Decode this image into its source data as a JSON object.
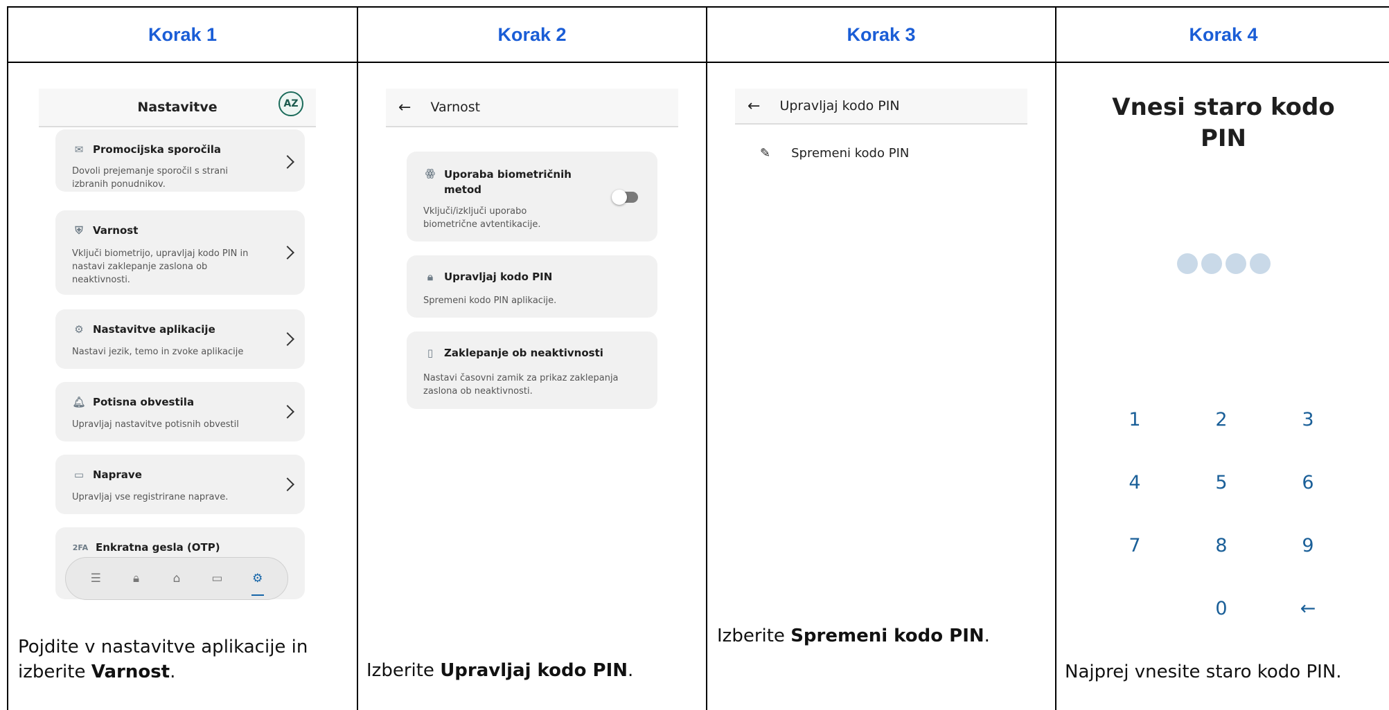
{
  "headers": [
    "Korak 1",
    "Korak 2",
    "Korak 3",
    "Korak 4"
  ],
  "step1": {
    "title": "Nastavitve",
    "avatar": "AZ",
    "items": [
      {
        "title": "Promocijska sporočila",
        "desc": "Dovoli prejemanje sporočil s strani izbranih ponudnikov.",
        "icon": "mail-icon"
      },
      {
        "title": "Varnost",
        "desc": "Vključi biometrijo, upravljaj kodo PIN in nastavi zaklepanje zaslona ob neaktivnosti.",
        "icon": "shield-icon"
      },
      {
        "title": "Nastavitve aplikacije",
        "desc": "Nastavi jezik, temo in zvoke aplikacije",
        "icon": "gear-icon"
      },
      {
        "title": "Potisna obvestila",
        "desc": "Upravljaj nastavitve potisnih obvestil",
        "icon": "bell-icon"
      },
      {
        "title": "Naprave",
        "desc": "Upravljaj vse registrirane naprave.",
        "icon": "devices-icon"
      },
      {
        "title": "Enkratna gesla (OTP)",
        "desc": "",
        "icon": "2fa-icon",
        "icon_text": "2FA"
      }
    ],
    "nav": [
      "list-icon",
      "lock-icon",
      "home-icon",
      "card-icon",
      "settings-icon"
    ],
    "caption_pre": "Pojdite v nastavitve aplikacije in izberite ",
    "caption_bold": "Varnost",
    "caption_post": "."
  },
  "step2": {
    "title": "Varnost",
    "items": [
      {
        "title": "Uporaba biometričnih metod",
        "desc": "Vključi/izključi uporabo biometrične avtentikacije.",
        "icon": "fingerprint-icon"
      },
      {
        "title": "Upravljaj kodo PIN",
        "desc": "Spremeni kodo PIN aplikacije.",
        "icon": "lock-icon"
      },
      {
        "title": "Zaklepanje ob neaktivnosti",
        "desc": "Nastavi časovni zamik za prikaz zaklepanja zaslona ob neaktivnosti.",
        "icon": "phone-lock-icon"
      }
    ],
    "caption_pre": "Izberite ",
    "caption_bold": "Upravljaj kodo PIN",
    "caption_post": "."
  },
  "step3": {
    "title": "Upravljaj kodo PIN",
    "row": "Spremeni kodo PIN",
    "caption_pre": "Izberite ",
    "caption_bold": "Spremeni kodo PIN",
    "caption_post": "."
  },
  "step4": {
    "title_line1": "Vnesi staro kodo",
    "title_line2": "PIN",
    "pin_length": 4,
    "keys": [
      "1",
      "2",
      "3",
      "4",
      "5",
      "6",
      "7",
      "8",
      "9",
      "0",
      "←"
    ],
    "caption": "Najprej vnesite staro kodo PIN."
  },
  "colors": {
    "accent": "#1a5dd6",
    "icon_blue": "#1565a8"
  }
}
